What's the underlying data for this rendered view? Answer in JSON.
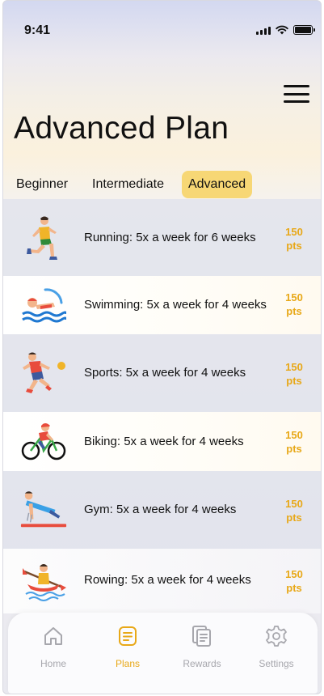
{
  "status_bar": {
    "time": "9:41"
  },
  "page": {
    "title": "Advanced Plan"
  },
  "tabs": [
    {
      "label": "Beginner",
      "active": false
    },
    {
      "label": "Intermediate",
      "active": false
    },
    {
      "label": "Advanced",
      "active": true
    }
  ],
  "plans": [
    {
      "icon": "running-icon",
      "label": "Running: 5x a week for 6 weeks",
      "pts_value": "150",
      "pts_unit": "pts"
    },
    {
      "icon": "swimming-icon",
      "label": "Swimming: 5x a week for 4 weeks",
      "pts_value": "150",
      "pts_unit": "pts"
    },
    {
      "icon": "sports-icon",
      "label": "Sports: 5x a week for 4 weeks",
      "pts_value": "150",
      "pts_unit": "pts"
    },
    {
      "icon": "biking-icon",
      "label": "Biking: 5x a week for 4 weeks",
      "pts_value": "150",
      "pts_unit": "pts"
    },
    {
      "icon": "gym-icon",
      "label": "Gym: 5x a week for 4 weeks",
      "pts_value": "150",
      "pts_unit": "pts"
    },
    {
      "icon": "rowing-icon",
      "label": "Rowing: 5x a week for 4 weeks",
      "pts_value": "150",
      "pts_unit": "pts"
    }
  ],
  "nav": [
    {
      "label": "Home",
      "icon": "home-icon",
      "active": false
    },
    {
      "label": "Plans",
      "icon": "plans-icon",
      "active": true
    },
    {
      "label": "Rewards",
      "icon": "rewards-icon",
      "active": false
    },
    {
      "label": "Settings",
      "icon": "settings-icon",
      "active": false
    }
  ],
  "colors": {
    "accent": "#e8a818",
    "tab_active_bg": "#f7d775",
    "nav_inactive": "#a7a7ad"
  }
}
